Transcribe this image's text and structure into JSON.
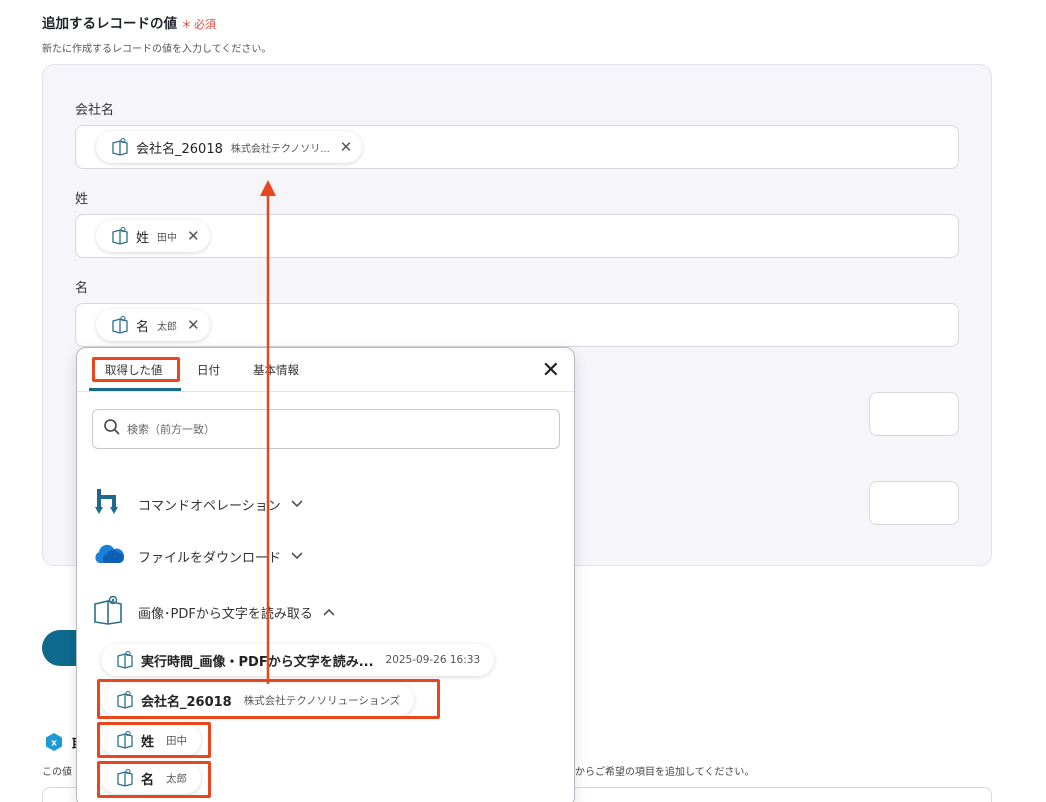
{
  "section": {
    "title": "追加するレコードの値",
    "required_mark": "＊",
    "required_label": "必須",
    "description": "新たに作成するレコードの値を入力してください。"
  },
  "fields": [
    {
      "label": "会社名",
      "chip_name": "会社名_26018",
      "chip_value": "株式会社テクノソリ..."
    },
    {
      "label": "姓",
      "chip_name": "姓",
      "chip_value": "田中"
    },
    {
      "label": "名",
      "chip_name": "名",
      "chip_value": "太郎"
    }
  ],
  "dropdown": {
    "tabs": [
      "取得した値",
      "日付",
      "基本情報"
    ],
    "search_placeholder": "検索（前方一致）",
    "groups": [
      {
        "label": "コマンドオペレーション",
        "icon": "command-operation-icon",
        "expanded": false
      },
      {
        "label": "ファイルをダウンロード",
        "icon": "onedrive-cloud-icon",
        "expanded": false
      },
      {
        "label": "画像･PDFから文字を読み取る",
        "icon": "ocr-book-icon",
        "expanded": true
      }
    ],
    "items": [
      {
        "name": "実行時間_画像・PDFから文字を読み...",
        "value": "2025-09-26 16:33"
      },
      {
        "name": "会社名_26018",
        "value": "株式会社テクノソリューションズ"
      },
      {
        "name": "姓",
        "value": "田中"
      },
      {
        "name": "名",
        "value": "太郎"
      }
    ]
  },
  "bottom": {
    "left_text": "この値",
    "right_text": "からご希望の項目を追加してください。"
  },
  "colors": {
    "highlight": "#e8461c",
    "accent": "#0d6a8e",
    "required": "#e5483d"
  }
}
